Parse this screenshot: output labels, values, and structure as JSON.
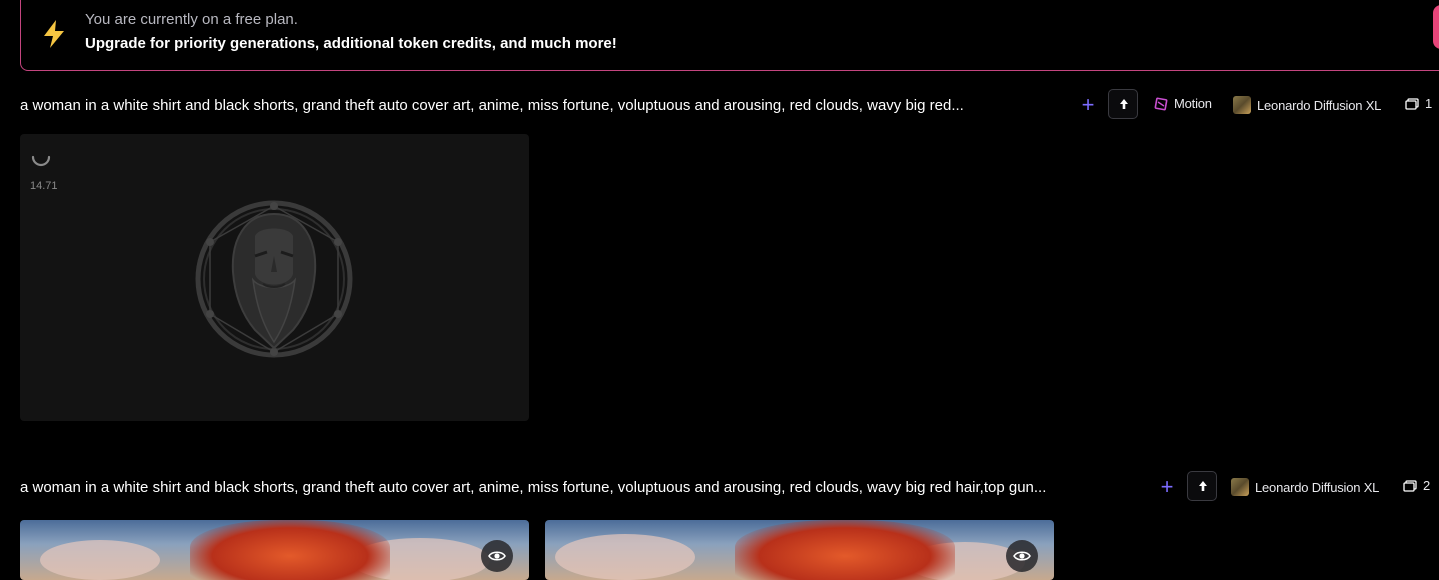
{
  "banner": {
    "line1": "You are currently on a free plan.",
    "line2": "Upgrade for priority generations, additional token credits, and much more!",
    "accent": "#e8457a"
  },
  "generations": [
    {
      "prompt": "a woman in a white shirt and black shorts, grand theft auto cover art, anime, miss fortune, voluptuous and arousing, red clouds, wavy big red...",
      "motion_label": "Motion",
      "model_label": "Leonardo Diffusion XL",
      "image_count": "1",
      "timer": "14.71"
    },
    {
      "prompt": "a woman in a white shirt and black shorts, grand theft auto cover art, anime, miss fortune, voluptuous and arousing, red clouds, wavy big red hair,top gun...",
      "model_label": "Leonardo Diffusion XL",
      "image_count": "2"
    }
  ],
  "icons": {
    "bolt": "lightning-icon",
    "plus": "plus-icon",
    "upscale": "arrow-up-icon",
    "motion": "motion-icon",
    "images": "image-stack-icon",
    "view": "eye-icon",
    "loading": "spinner-icon"
  },
  "colors": {
    "accent_purple": "#7c6cff",
    "bolt_yellow": "#f5c542",
    "card_bg": "#131313"
  }
}
